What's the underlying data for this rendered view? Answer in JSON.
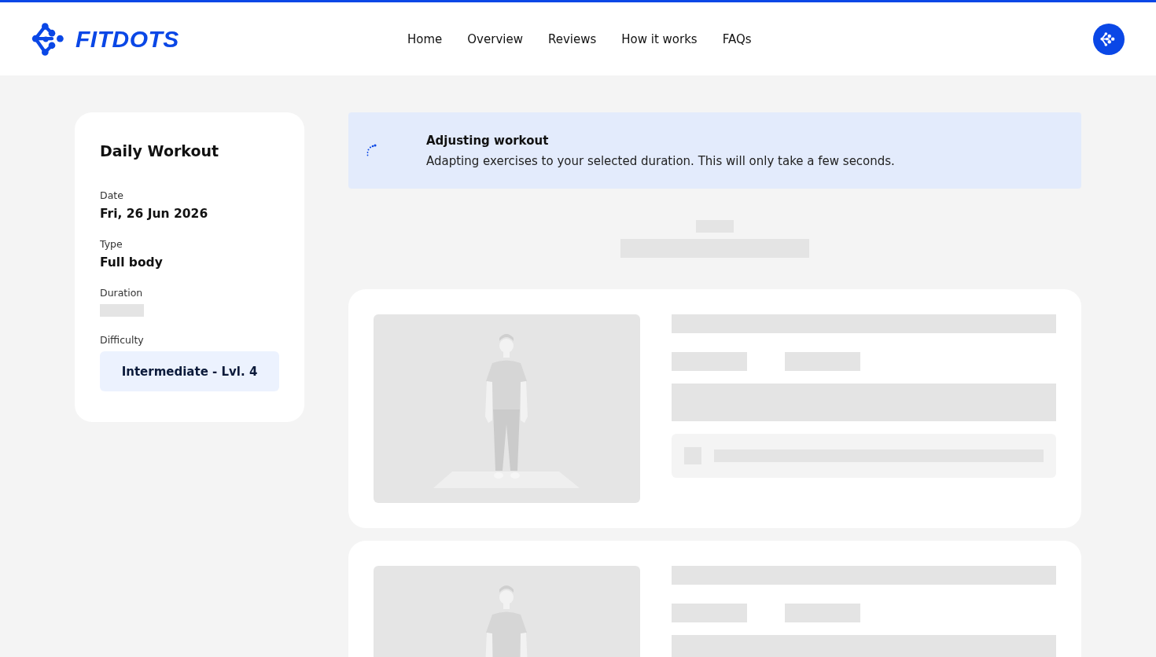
{
  "header": {
    "logo_text": "FITDOTS",
    "nav": [
      "Home",
      "Overview",
      "Reviews",
      "How it works",
      "FAQs"
    ]
  },
  "workout": {
    "title": "Daily Workout",
    "fields": [
      {
        "label": "Date",
        "value": "Fri, 26 Jun 2026",
        "kind": "text"
      },
      {
        "label": "Type",
        "value": "Full body",
        "kind": "text"
      },
      {
        "label": "Duration",
        "kind": "loading"
      },
      {
        "label": "Difficulty",
        "value": "Intermediate - Lvl. 4",
        "kind": "badge"
      }
    ]
  },
  "notice": {
    "title": "Adjusting workout",
    "message": "Adapting exercises to your selected duration. This will only take a few seconds."
  }
}
